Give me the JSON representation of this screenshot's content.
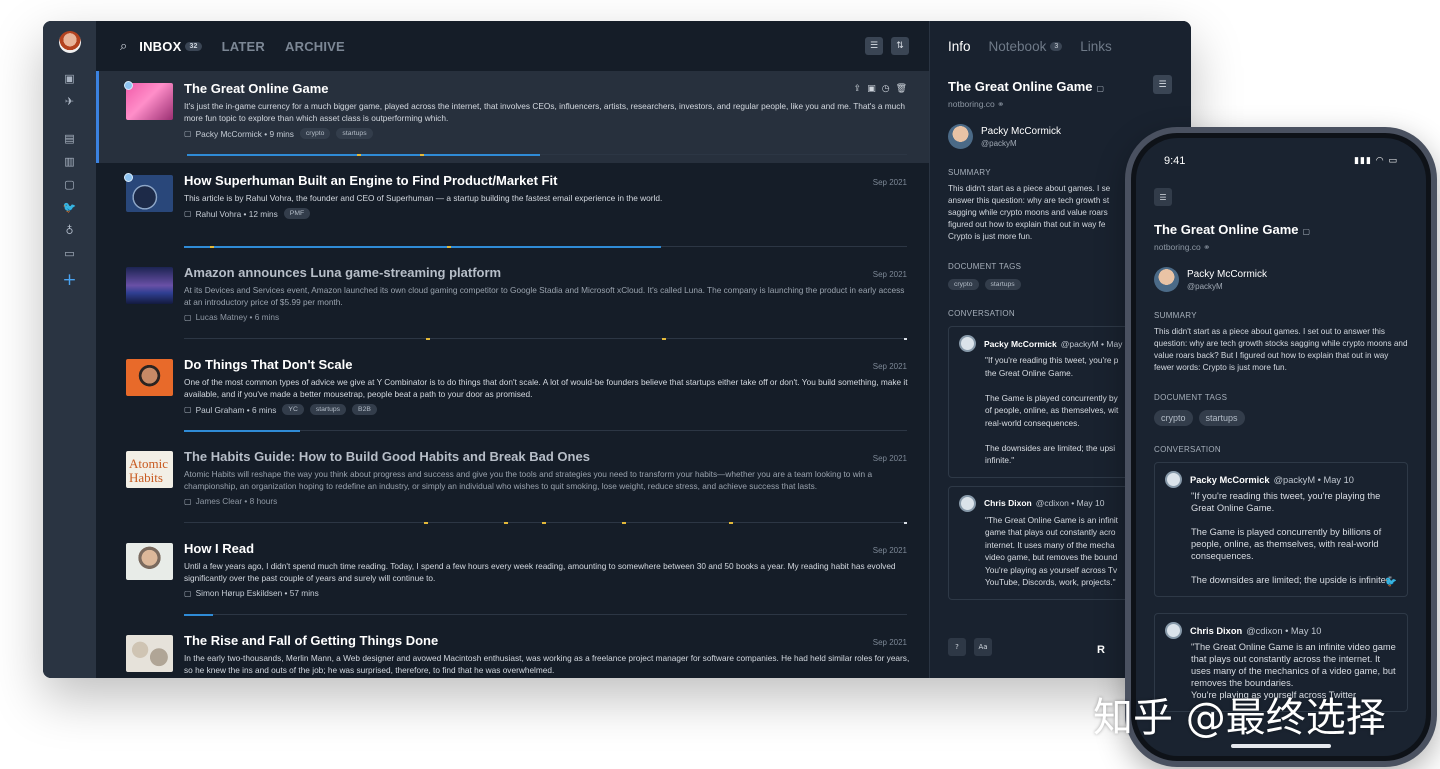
{
  "list": {
    "tabs": [
      {
        "label": "INBOX",
        "count": "32"
      },
      {
        "label": "LATER"
      },
      {
        "label": "ARCHIVE"
      }
    ],
    "articles": [
      {
        "title": "The Great Online Game",
        "summary": "It's just the in-game currency for a much bigger game, played across the internet, that involves CEOs, influencers, artists, researchers, investors, and regular people, like you and me. That's a much more fun topic to explore than which asset class is outperforming which.",
        "meta": "Packy McCormick • 9 mins",
        "tags": [
          "crypto",
          "startups"
        ],
        "date": "",
        "progress": 0.49
      },
      {
        "title": "How Superhuman Built an Engine to Find Product/Market Fit",
        "summary": "This article is by Rahul Vohra, the founder and CEO of Superhuman — a startup building the fastest email experience in the world.",
        "meta": "Rahul Vohra • 12 mins",
        "tags": [
          "PMF"
        ],
        "date": "Sep 2021",
        "progress": 0.66
      },
      {
        "title": "Amazon announces Luna game-streaming platform",
        "summary": "At its Devices and Services event, Amazon launched its own cloud gaming competitor to Google Stadia and Microsoft xCloud. It's called Luna. The company is launching the product in early access at an introductory price of $5.99 per month.",
        "meta": "Lucas Matney • 6 mins",
        "tags": [],
        "date": "Sep 2021",
        "progress": 0
      },
      {
        "title": "Do Things That Don't Scale",
        "summary": "One of the most common types of advice we give at Y Combinator is to do things that don't scale. A lot of would-be founders believe that startups either take off or don't. You build something, make it available, and if you've made a better mousetrap, people beat a path to your door as promised.",
        "meta": "Paul Graham • 6 mins",
        "tags": [
          "YC",
          "startups",
          "B2B"
        ],
        "date": "Sep 2021",
        "progress": 0.16
      },
      {
        "title": "The Habits Guide: How to Build Good Habits and Break Bad Ones",
        "summary": "Atomic Habits will reshape the way you think about progress and success and give you the tools and strategies you need to transform your habits—whether you are a team looking to win a championship, an organization hoping to redefine an industry, or simply an individual who wishes to quit smoking, lose weight, reduce stress, and achieve success that lasts.",
        "meta": "James Clear • 8 hours",
        "tags": [],
        "date": "Sep 2021",
        "progress": 0
      },
      {
        "title": "How I Read",
        "summary": "Until a few years ago, I didn't spend much time reading. Today, I spend a few hours every week reading, amounting to somewhere between 30 and 50 books a year. My reading habit has evolved significantly over the past couple of years and surely will continue to.",
        "meta": "Simon Hørup Eskildsen • 57 mins",
        "tags": [],
        "date": "Sep 2021",
        "progress": 0.04
      },
      {
        "title": "The Rise and Fall of Getting Things Done",
        "summary": "In the early two-thousands, Merlin Mann, a Web designer and avowed Macintosh enthusiast, was working as a freelance project manager for software companies. He had held similar roles for years, so he knew the ins and outs of the job; he was surprised, therefore, to find that he was overwhelmed.",
        "meta": "",
        "tags": [],
        "date": "Sep 2021",
        "progress": 0
      }
    ]
  },
  "info": {
    "tabs": [
      {
        "label": "Info"
      },
      {
        "label": "Notebook",
        "count": "3"
      },
      {
        "label": "Links"
      }
    ],
    "title": "The Great Online Game",
    "domain": "notboring.co",
    "author": {
      "name": "Packy McCormick",
      "handle": "@packyM"
    },
    "summary_heading": "SUMMARY",
    "summary_lines": [
      "This didn't start as a piece about games. I se",
      "answer this question: why are tech growth st",
      "sagging while crypto moons and value roars",
      "figured out how to explain that out in way fe",
      "Crypto is just more fun."
    ],
    "tags_heading": "DOCUMENT TAGS",
    "tags": [
      "crypto",
      "startups"
    ],
    "conversation_heading": "CONVERSATION",
    "conversation": [
      {
        "who": "Packy McCormick",
        "sub": "@packyM • May",
        "text": "\"If you're reading this tweet, you're p\nthe Great Online Game.\n\nThe Game is played concurrently by\nof people, online, as themselves, wit\nreal-world consequences.\n\nThe downsides are limited; the upsi\ninfinite.\""
      },
      {
        "who": "Chris Dixon",
        "sub": "@cdixon • May 10",
        "text": "\"The Great Online Game is an infinit\ngame that plays out constantly acro\ninternet. It uses many of the mecha\nvideo game, but removes the bound\nYou're playing as yourself across Tv\nYouTube, Discords, work, projects.\""
      }
    ],
    "footer_font_label": "Aa",
    "footer_logo": "R"
  },
  "phone": {
    "time": "9:41",
    "title": "The Great Online Game",
    "domain": "notboring.co",
    "author": {
      "name": "Packy McCormick",
      "handle": "@packyM"
    },
    "summary_heading": "SUMMARY",
    "summary": "This didn't start as a piece about games. I set out to answer this question: why are tech growth stocks sagging while crypto moons and value roars back? But I figured out how to explain that out in way fewer words: Crypto is just more fun.",
    "tags_heading": "DOCUMENT TAGS",
    "tags": [
      "crypto",
      "startups"
    ],
    "conversation_heading": "CONVERSATION",
    "conversation": [
      {
        "who": "Packy McCormick",
        "sub": "@packyM • May 10",
        "text": "\"If you're reading this tweet, you're playing the Great Online Game.\n\nThe Game is played concurrently by billions of people, online, as themselves, with real-world consequences.\n\nThe downsides are limited; the upside is infinite.\""
      },
      {
        "who": "Chris Dixon",
        "sub": "@cdixon • May 10",
        "text": "\"The Great Online Game is an infinite video game that plays out constantly across the internet. It uses many of the mechanics of a video game, but removes the boundaries.\nYou're playing as yourself across Twitter"
      }
    ]
  },
  "watermark": "知乎 @最终选择",
  "colors": {
    "accent": "#2f8bd6",
    "background": "#151d28",
    "panel": "#19222f",
    "highlight": "#e2b83a"
  },
  "icons": [
    "search-icon",
    "list-view-icon",
    "sort-icon",
    "share-icon",
    "archive-icon",
    "clock-icon",
    "trash-icon",
    "document-icon",
    "link-icon",
    "twitter-icon",
    "help-icon",
    "plus-icon"
  ]
}
